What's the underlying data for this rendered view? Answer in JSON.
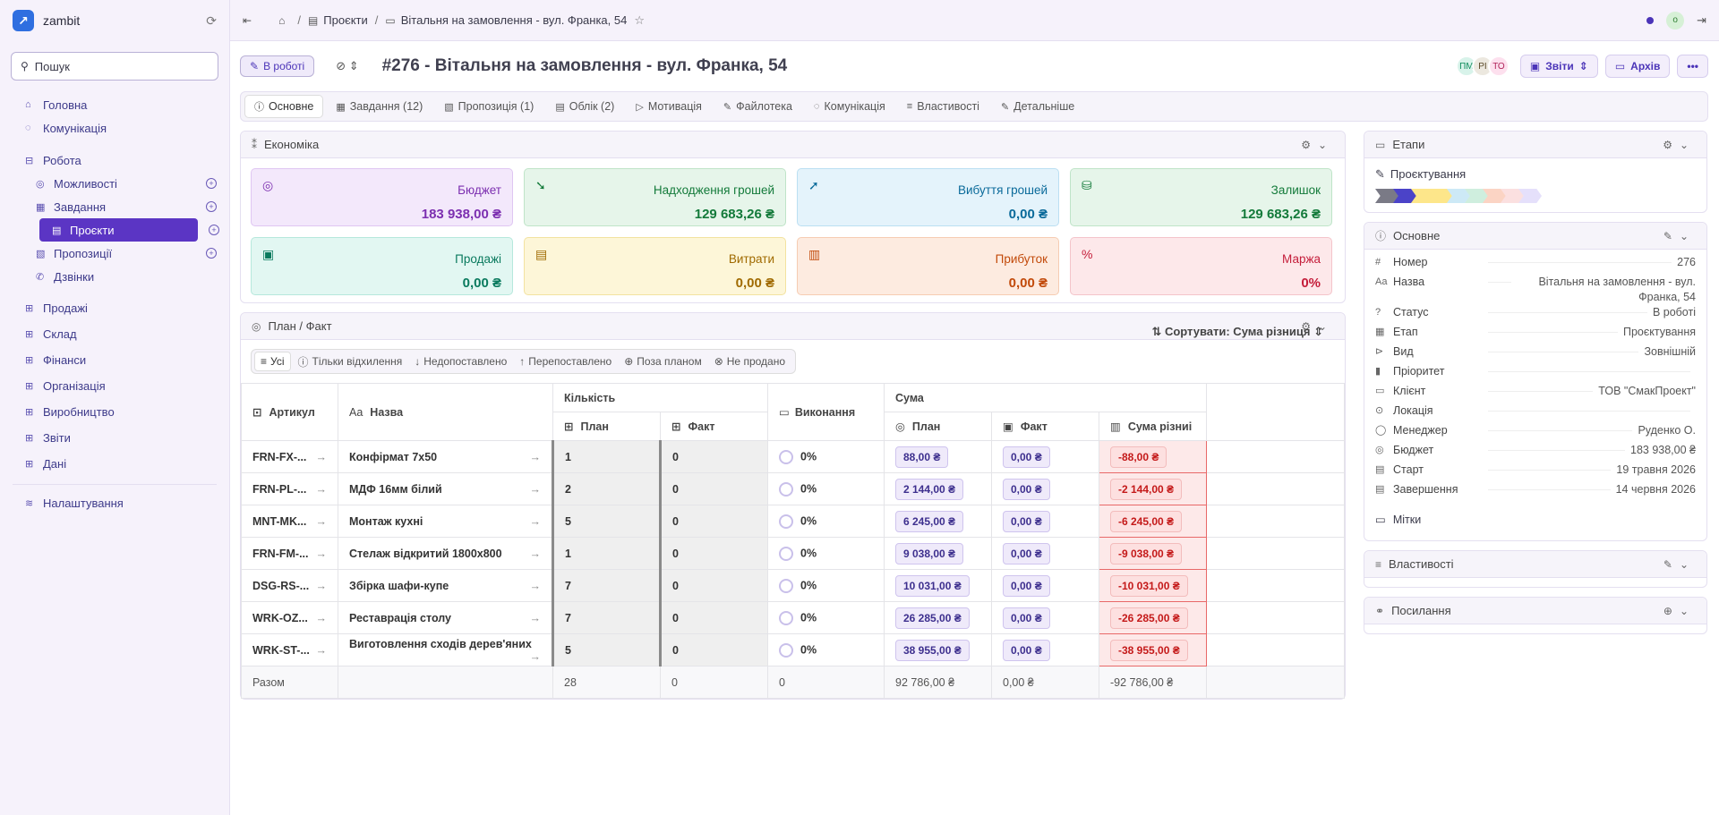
{
  "app": {
    "name": "zambit",
    "logo": "↗"
  },
  "search": {
    "label": "Пошук"
  },
  "sidebar": {
    "home": "Головна",
    "comms": "Комунікація",
    "work": "Робота",
    "sub": [
      {
        "label": "Можливості",
        "icon": "target-icon"
      },
      {
        "label": "Завдання",
        "icon": "tasks-icon"
      },
      {
        "label": "Проєкти",
        "icon": "projects-icon"
      },
      {
        "label": "Пропозиції",
        "icon": "offers-icon"
      },
      {
        "label": "Дзвінки",
        "icon": "phone-icon"
      }
    ],
    "groups": [
      "Продажі",
      "Склад",
      "Фінанси",
      "Організація",
      "Виробництво",
      "Звіти",
      "Дані"
    ],
    "settings": "Налаштування"
  },
  "topbar": {
    "crumb1": "Проєкти",
    "crumb2": "Вітальня на замовлення - вул. Франка, 54",
    "avatar": "o"
  },
  "header": {
    "status": "В роботі",
    "title": "#276 - Вітальня на замовлення - вул. Франка, 54",
    "avatars": [
      {
        "initials": "ПМ",
        "bg": "#d8f3ea",
        "fg": "#0a8a5a"
      },
      {
        "initials": "РІ",
        "bg": "#ece8df",
        "fg": "#5a4a2a"
      },
      {
        "initials": "ТО",
        "bg": "#fde0ee",
        "fg": "#b0245a"
      }
    ],
    "reports": "Звіти",
    "archive": "Архів",
    "more": "•••"
  },
  "tabs": [
    "Основне",
    "Завдання (12)",
    "Пропозиція (1)",
    "Облік (2)",
    "Мотивація",
    "Файлотека",
    "Комунікація",
    "Властивості",
    "Детальніше"
  ],
  "economics": {
    "title": "Економіка",
    "cards": [
      {
        "label": "Бюджет",
        "value": "183 938,00 ₴",
        "bg": "#f3e8fb",
        "border": "#dfc6f2",
        "fg": "#7c2fb0",
        "icon": "◎"
      },
      {
        "label": "Надходження грошей",
        "value": "129 683,26 ₴",
        "bg": "#e6f5ea",
        "border": "#bfe4c8",
        "fg": "#137a3a",
        "icon": "➘"
      },
      {
        "label": "Вибуття грошей",
        "value": "0,00 ₴",
        "bg": "#e4f3fb",
        "border": "#bbdff2",
        "fg": "#0a6a9a",
        "icon": "➚"
      },
      {
        "label": "Залишок",
        "value": "129 683,26 ₴",
        "bg": "#e6f5ea",
        "border": "#bfe4c8",
        "fg": "#137a3a",
        "icon": "⛁"
      },
      {
        "label": "Продажі",
        "value": "0,00 ₴",
        "bg": "#e2f7f2",
        "border": "#b6e8dc",
        "fg": "#0a7a5e",
        "icon": "▣"
      },
      {
        "label": "Витрати",
        "value": "0,00 ₴",
        "bg": "#fdf6d8",
        "border": "#f2e2a0",
        "fg": "#a06a00",
        "icon": "▤"
      },
      {
        "label": "Прибуток",
        "value": "0,00 ₴",
        "bg": "#fdebe0",
        "border": "#f6ccb2",
        "fg": "#c24a0a",
        "icon": "▥"
      },
      {
        "label": "Маржа",
        "value": "0%",
        "bg": "#fde8ea",
        "border": "#f4c4ca",
        "fg": "#c41d3a",
        "icon": "%"
      }
    ]
  },
  "planfact": {
    "title": "План / Факт",
    "filters": [
      "Усі",
      "Тільки відхилення",
      "Недопоставлено",
      "Перепоставлено",
      "Поза планом",
      "Не продано"
    ],
    "sort": "Сортувати: Сума різниця",
    "headers": {
      "article": "Артикул",
      "name": "Назва",
      "qty": "Кількість",
      "plan": "План",
      "fact": "Факт",
      "exec": "Виконання",
      "sum": "Сума",
      "splan": "План",
      "sfact": "Факт",
      "sdiff": "Сума різниі"
    },
    "rows": [
      {
        "article": "FRN-FX-...",
        "name": "Конфірмат 7х50",
        "plan": "1",
        "fact": "0",
        "exec": "0%",
        "splan": "88,00 ₴",
        "sfact": "0,00 ₴",
        "sdiff": "-88,00 ₴"
      },
      {
        "article": "FRN-PL-...",
        "name": "МДФ 16мм білий",
        "plan": "2",
        "fact": "0",
        "exec": "0%",
        "splan": "2 144,00 ₴",
        "sfact": "0,00 ₴",
        "sdiff": "-2 144,00 ₴"
      },
      {
        "article": "MNT-MK...",
        "name": "Монтаж кухні",
        "plan": "5",
        "fact": "0",
        "exec": "0%",
        "splan": "6 245,00 ₴",
        "sfact": "0,00 ₴",
        "sdiff": "-6 245,00 ₴"
      },
      {
        "article": "FRN-FM-...",
        "name": "Стелаж відкритий 1800х800",
        "plan": "1",
        "fact": "0",
        "exec": "0%",
        "splan": "9 038,00 ₴",
        "sfact": "0,00 ₴",
        "sdiff": "-9 038,00 ₴"
      },
      {
        "article": "DSG-RS-...",
        "name": "Збірка шафи-купе",
        "plan": "7",
        "fact": "0",
        "exec": "0%",
        "splan": "10 031,00 ₴",
        "sfact": "0,00 ₴",
        "sdiff": "-10 031,00 ₴"
      },
      {
        "article": "WRK-OZ...",
        "name": "Реставрація столу",
        "plan": "7",
        "fact": "0",
        "exec": "0%",
        "splan": "26 285,00 ₴",
        "sfact": "0,00 ₴",
        "sdiff": "-26 285,00 ₴"
      },
      {
        "article": "WRK-ST-...",
        "name": "Виготовлення сходів дерев'яних",
        "plan": "5",
        "fact": "0",
        "exec": "0%",
        "splan": "38 955,00 ₴",
        "sfact": "0,00 ₴",
        "sdiff": "-38 955,00 ₴"
      }
    ],
    "total": {
      "label": "Разом",
      "plan": "28",
      "fact": "0",
      "exec": "0",
      "splan": "92 786,00 ₴",
      "sfact": "0,00 ₴",
      "sdiff": "-92 786,00 ₴"
    }
  },
  "right": {
    "etapy": {
      "title": "Етапи",
      "current": "Проєктування",
      "colors": [
        "#7a7a86",
        "#4b43c8",
        "#fde68a",
        "#fde68a",
        "#cde9f6",
        "#cfeede",
        "#fbd4c4",
        "#fbe0e0",
        "#e5e0fb"
      ]
    },
    "basic": {
      "title": "Основне",
      "rows": [
        {
          "icon": "#",
          "k": "Номер",
          "v": "276"
        },
        {
          "icon": "Aa",
          "k": "Назва",
          "v": "Вітальня на замовлення - вул. Франка, 54"
        },
        {
          "icon": "?",
          "k": "Статус",
          "v": "В роботі"
        },
        {
          "icon": "▦",
          "k": "Етап",
          "v": "Проєктування"
        },
        {
          "icon": "⊳",
          "k": "Вид",
          "v": "Зовнішній"
        },
        {
          "icon": "▮",
          "k": "Пріоритет",
          "v": ""
        },
        {
          "icon": "▭",
          "k": "Клієнт",
          "v": "ТОВ \"СмакПроект\""
        },
        {
          "icon": "⊙",
          "k": "Локація",
          "v": ""
        },
        {
          "icon": "◯",
          "k": "Менеджер",
          "v": "Руденко О."
        },
        {
          "icon": "◎",
          "k": "Бюджет",
          "v": "183 938,00 ₴"
        },
        {
          "icon": "▤",
          "k": "Старт",
          "v": "19 травня 2026"
        },
        {
          "icon": "▤",
          "k": "Завершення",
          "v": "14 червня 2026"
        }
      ],
      "tags": "Мітки"
    },
    "props": "Властивості",
    "links": "Посилання"
  }
}
